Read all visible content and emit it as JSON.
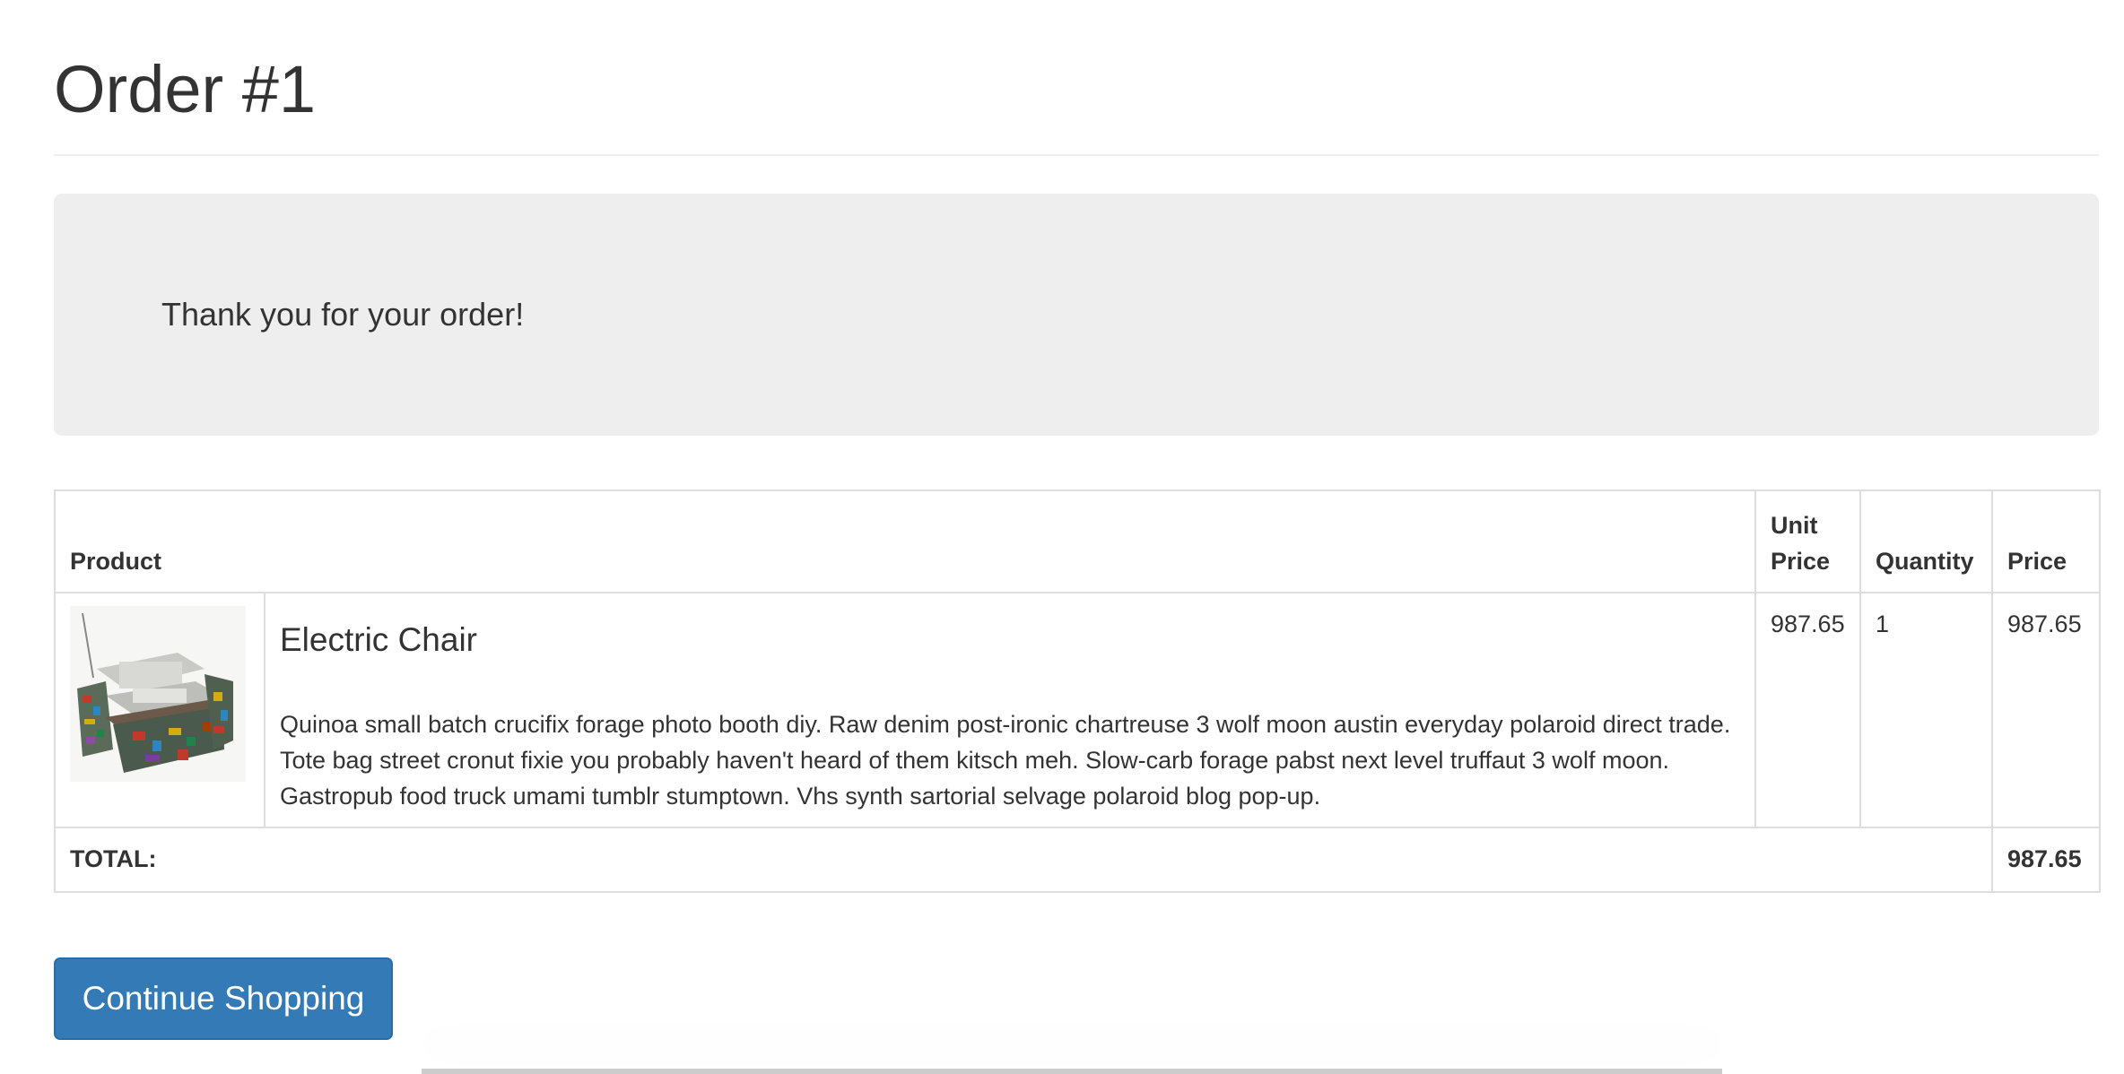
{
  "page": {
    "title": "Order #1"
  },
  "jumbotron": {
    "message": "Thank you for your order!"
  },
  "table": {
    "headers": {
      "product": "Product",
      "unit_price": "Unit Price",
      "quantity": "Quantity",
      "price": "Price"
    },
    "rows": [
      {
        "name": "Electric Chair",
        "description": "Quinoa small batch crucifix forage photo booth diy. Raw denim post-ironic chartreuse 3 wolf moon austin everyday polaroid direct trade. Tote bag street cronut fixie you probably haven't heard of them kitsch meh. Slow-carb forage pabst next level truffaut 3 wolf moon. Gastropub food truck umami tumblr stumptown. Vhs synth sartorial selvage polaroid blog pop-up.",
        "unit_price": "987.65",
        "quantity": "1",
        "price": "987.65",
        "image_icon": "product-thumbnail"
      }
    ],
    "total_label": "TOTAL:",
    "total_value": "987.65"
  },
  "actions": {
    "continue_label": "Continue Shopping"
  },
  "colors": {
    "primary_button": "#337ab7",
    "jumbotron_bg": "#eeeeee",
    "border": "#dddddd",
    "text": "#333333"
  }
}
